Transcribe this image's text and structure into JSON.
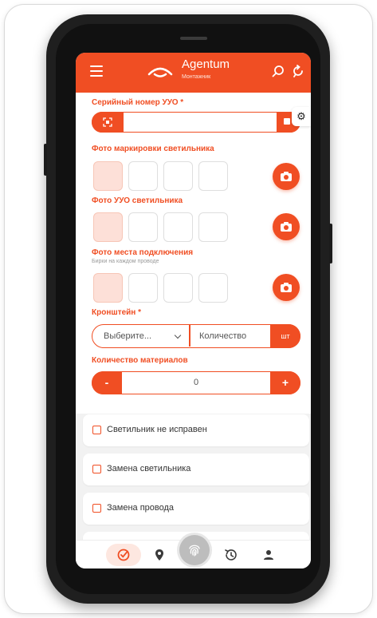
{
  "app": {
    "title": "Agentum",
    "subtitle": "Монтажник"
  },
  "colors": {
    "accent": "#f04e23",
    "accent_light": "#fde0d8"
  },
  "icons": {
    "menu": "hamburger-icon",
    "logo": "agentum-logo-icon",
    "search": "search-icon",
    "refresh": "refresh-icon",
    "scan": "qr-scan-icon",
    "settings": "gear-icon",
    "camera": "camera-icon",
    "nav": [
      "check-circle-icon",
      "location-pin-icon",
      "fingerprint-icon",
      "history-icon",
      "user-icon"
    ]
  },
  "form": {
    "serial_label": "Серийный номер УУО *",
    "serial_value": "",
    "marking_label": "Фото маркировки светильника",
    "uuo_photo_label": "Фото УУО светильника",
    "connection_label": "Фото места подключения",
    "connection_hint": "Бирки на каждом проводе",
    "bracket_label": "Кронштейн *",
    "bracket_select": "Выберите...",
    "bracket_qty_placeholder": "Количество",
    "bracket_unit": "шт",
    "materials_label": "Количество материалов",
    "materials_minus": "-",
    "materials_value": "0",
    "materials_plus": "+"
  },
  "checks": [
    {
      "label": "Светильник не исправен",
      "checked": false
    },
    {
      "label": "Замена светильника",
      "checked": false
    },
    {
      "label": "Замена провода",
      "checked": false
    }
  ]
}
